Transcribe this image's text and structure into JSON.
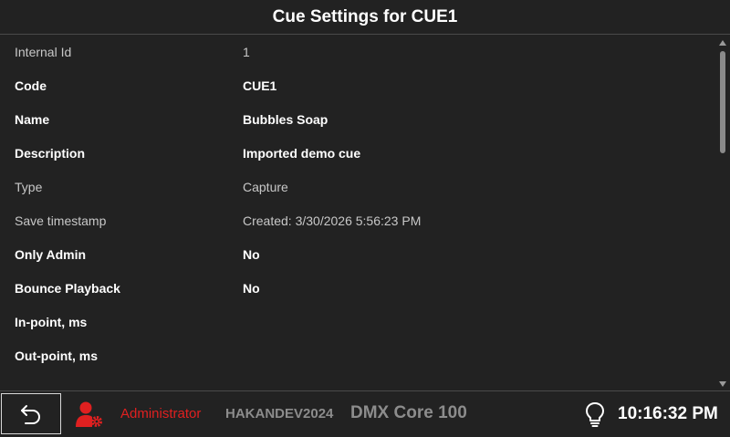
{
  "header": {
    "title": "Cue Settings for CUE1"
  },
  "rows": [
    {
      "label": "Internal Id",
      "value": "1"
    },
    {
      "label": "Code",
      "value": "CUE1"
    },
    {
      "label": "Name",
      "value": "Bubbles Soap"
    },
    {
      "label": "Description",
      "value": "Imported demo cue"
    },
    {
      "label": "Type",
      "value": "Capture"
    },
    {
      "label": "Save timestamp",
      "value": "Created: 3/30/2026 5:56:23 PM"
    },
    {
      "label": "Only Admin",
      "value": "No"
    },
    {
      "label": "Bounce Playback",
      "value": "No"
    },
    {
      "label": "In-point, ms",
      "value": ""
    },
    {
      "label": "Out-point, ms",
      "value": ""
    }
  ],
  "footer": {
    "back_icon": "undo-arrow-icon",
    "user_icon": "user-settings-icon",
    "user_name": "Administrator",
    "host_name": "HAKANDEV2024",
    "device_name": "DMX Core 100",
    "bulb_icon": "lightbulb-icon",
    "clock": "10:16:32 PM"
  },
  "colors": {
    "background": "#222222",
    "user_accent": "#e02020",
    "muted_text": "#8c8c8c"
  }
}
